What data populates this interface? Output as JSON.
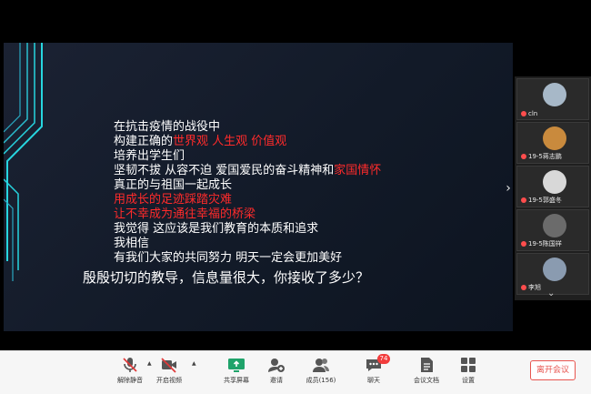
{
  "slide": {
    "lines": [
      {
        "segments": [
          {
            "text": "在抗击疫情的战役中",
            "color": "white"
          }
        ]
      },
      {
        "segments": [
          {
            "text": "构建正确的",
            "color": "white"
          },
          {
            "text": "世界观 人生观 价值观",
            "color": "red"
          }
        ]
      },
      {
        "segments": [
          {
            "text": "培养出学生们",
            "color": "white"
          }
        ]
      },
      {
        "segments": [
          {
            "text": "坚韧不拔 从容不迫 爱国爱民的奋斗精神和",
            "color": "white"
          },
          {
            "text": "家国情怀",
            "color": "red"
          }
        ]
      },
      {
        "segments": [
          {
            "text": "真正的与祖国一起成长",
            "color": "white"
          }
        ]
      },
      {
        "segments": [
          {
            "text": "用成长的足迹踩踏灾难",
            "color": "red"
          }
        ]
      },
      {
        "segments": [
          {
            "text": "让不幸成为通往幸福的桥梁",
            "color": "red"
          }
        ]
      },
      {
        "segments": [
          {
            "text": "我觉得 这应该是我们教育的本质和追求",
            "color": "white"
          }
        ]
      },
      {
        "segments": [
          {
            "text": "我相信",
            "color": "white"
          }
        ]
      },
      {
        "segments": [
          {
            "text": "有我们大家的共同努力 明天一定会更加美好",
            "color": "white"
          }
        ]
      }
    ],
    "question": "殷殷切切的教导，信息量很大，你接收了多少？",
    "colors": {
      "white": "#ffffff",
      "red": "#ff2b2b"
    }
  },
  "gallery": {
    "participants": [
      {
        "name": "cln",
        "avatar_icon": "avatar-dark-circle-icon",
        "avatar_color": "#a7b8c8"
      },
      {
        "name": "19-5蒋志鹏",
        "avatar_icon": "avatar-dog-icon",
        "avatar_color": "#c98a3d"
      },
      {
        "name": "19-5郭盛冬",
        "avatar_icon": "avatar-figure-icon",
        "avatar_color": "#d8d8d8"
      },
      {
        "name": "19-5陈国祥",
        "avatar_icon": "avatar-bw-icon",
        "avatar_color": "#6b6b6b"
      },
      {
        "name": "李旭",
        "avatar_icon": "avatar-rocket-icon",
        "avatar_color": "#8a9bb0"
      }
    ]
  },
  "toolbar": {
    "buttons": [
      {
        "id": "mute",
        "label": "解除静音",
        "icon": "mic-off-icon"
      },
      {
        "id": "video",
        "label": "开启视频",
        "icon": "camera-off-icon"
      },
      {
        "id": "share",
        "label": "共享屏幕",
        "icon": "share-screen-icon"
      },
      {
        "id": "invite",
        "label": "邀请",
        "icon": "invite-icon"
      },
      {
        "id": "members",
        "label": "成员(156)",
        "icon": "members-icon"
      },
      {
        "id": "chat",
        "label": "聊天",
        "icon": "chat-icon",
        "badge": "74"
      },
      {
        "id": "docs",
        "label": "会议文档",
        "icon": "document-icon"
      },
      {
        "id": "settings",
        "label": "设置",
        "icon": "settings-grid-icon"
      }
    ],
    "leave_label": "离开会议"
  }
}
